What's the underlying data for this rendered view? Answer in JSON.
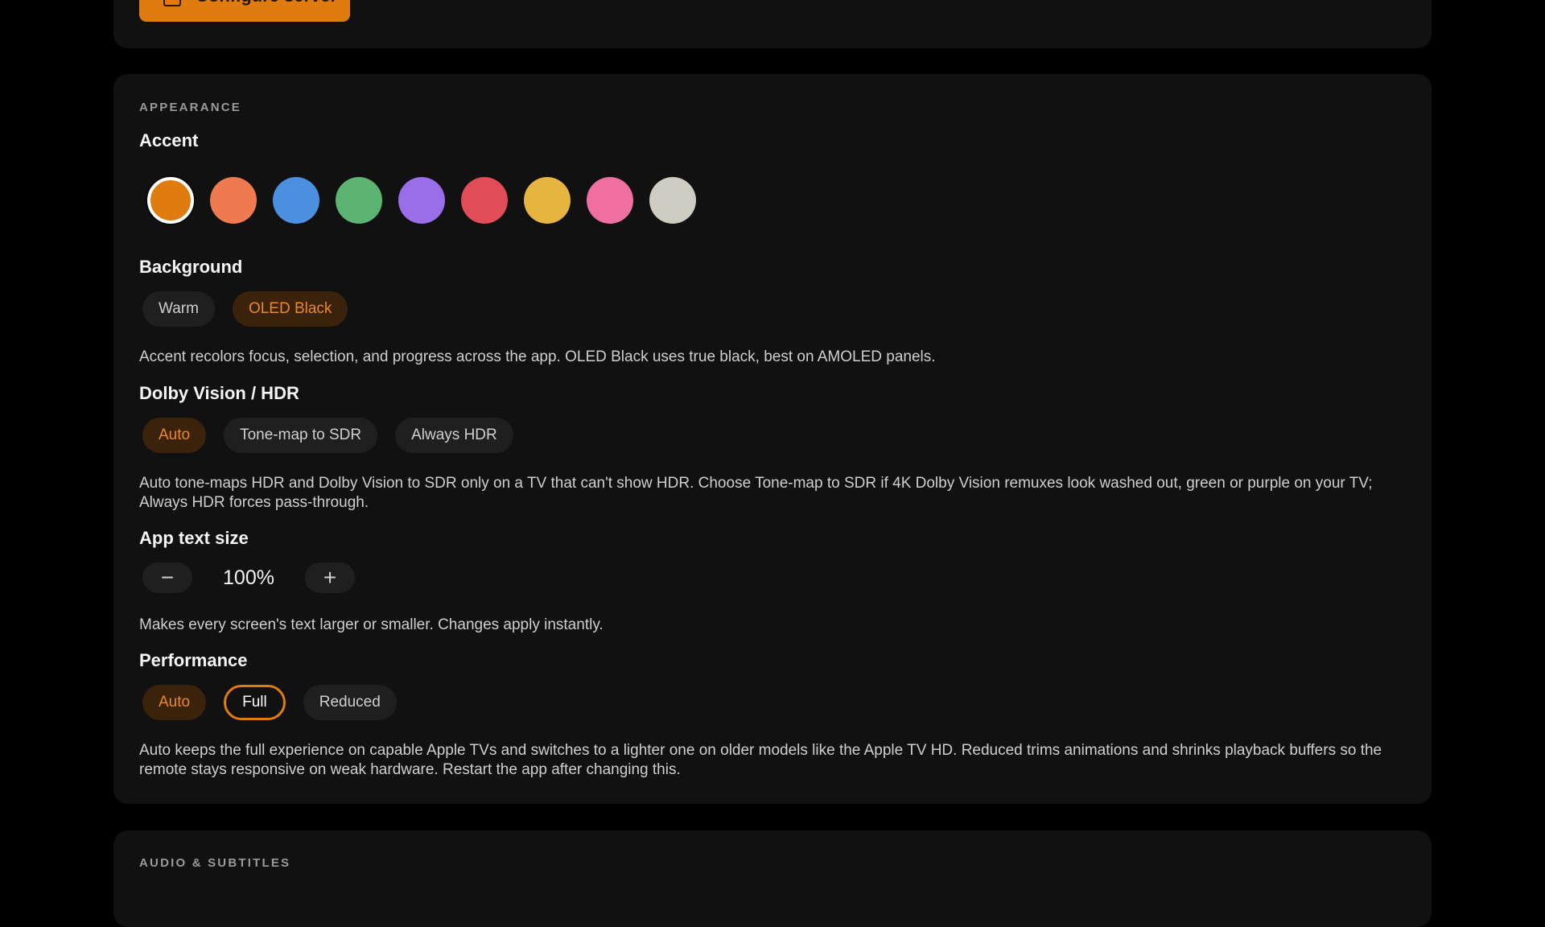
{
  "top_card": {
    "configure_label": "Configure server"
  },
  "appearance": {
    "section_label": "APPEARANCE",
    "accent": {
      "title": "Accent",
      "swatches": [
        "#e07b10",
        "#f07a4f",
        "#4a8fe0",
        "#5bb472",
        "#9a6ee8",
        "#e04c58",
        "#e8b440",
        "#ee6fa0",
        "#cfccc2"
      ],
      "selected_index": 0
    },
    "background": {
      "title": "Background",
      "options": [
        "Warm",
        "OLED Black"
      ],
      "selected": "OLED Black",
      "description": "Accent recolors focus, selection, and progress across the app. OLED Black uses true black, best on AMOLED panels."
    },
    "hdr": {
      "title": "Dolby Vision / HDR",
      "options": [
        "Auto",
        "Tone-map to SDR",
        "Always HDR"
      ],
      "selected": "Auto",
      "description": "Auto tone-maps HDR and Dolby Vision to SDR only on a TV that can't show HDR. Choose Tone-map to SDR if 4K Dolby Vision remuxes look washed out, green or purple on your TV; Always HDR forces pass-through."
    },
    "text_size": {
      "title": "App text size",
      "minus": "−",
      "value": "100%",
      "plus": "+",
      "description": "Makes every screen's text larger or smaller. Changes apply instantly."
    },
    "performance": {
      "title": "Performance",
      "options": [
        "Auto",
        "Full",
        "Reduced"
      ],
      "selected": "Auto",
      "focused": "Full",
      "description": "Auto keeps the full experience on capable Apple TVs and switches to a lighter one on older models like the Apple TV HD. Reduced trims animations and shrinks playback buffers so the remote stays responsive on weak hardware. Restart the app after changing this."
    }
  },
  "audio": {
    "section_label": "AUDIO & SUBTITLES"
  }
}
